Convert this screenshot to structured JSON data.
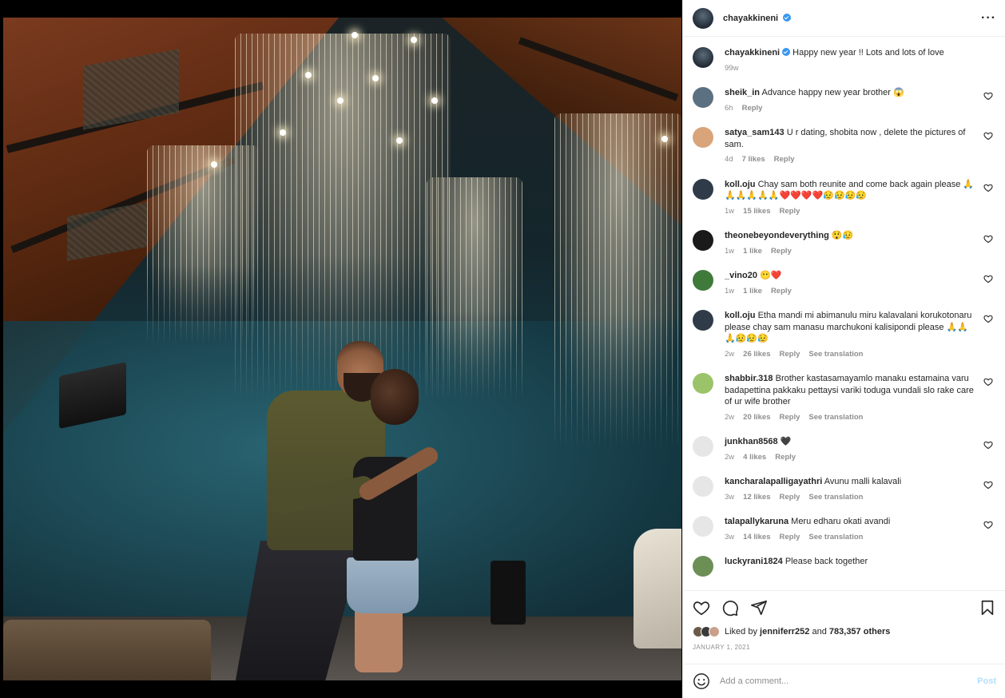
{
  "post": {
    "author": "chayakkineni",
    "verified": true,
    "more_icon": "more-horizontal-icon"
  },
  "caption": {
    "username": "chayakkineni",
    "text": "Happy new year !! Lots and lots of love",
    "time": "99w"
  },
  "comments": [
    {
      "username": "sheik_in",
      "text": "Advance happy new year brother 😱",
      "time": "6h",
      "likes": "",
      "reply": "Reply",
      "translate": ""
    },
    {
      "username": "satya_sam143",
      "text": "U r dating, shobita now , delete the pictures of sam.",
      "time": "4d",
      "likes": "7 likes",
      "reply": "Reply",
      "translate": ""
    },
    {
      "username": "koll.oju",
      "text": "Chay sam both reunite and come back again please 🙏🙏🙏🙏🙏🙏❤️❤️❤️❤️😥😥😥😥",
      "time": "1w",
      "likes": "15 likes",
      "reply": "Reply",
      "translate": ""
    },
    {
      "username": "theonebeyondeverything",
      "text": "😲😥",
      "time": "1w",
      "likes": "1 like",
      "reply": "Reply",
      "translate": ""
    },
    {
      "username": "_vino20",
      "text": "😶❤️",
      "time": "1w",
      "likes": "1 like",
      "reply": "Reply",
      "translate": ""
    },
    {
      "username": "koll.oju",
      "text": "Etha mandi mi abimanulu miru kalavalani korukotonaru please chay sam manasu marchukoni kalisipondi please 🙏🙏🙏😥😥😥",
      "time": "2w",
      "likes": "26 likes",
      "reply": "Reply",
      "translate": "See translation"
    },
    {
      "username": "shabbir.318",
      "text": "Brother kastasamayamlo manaku estamaina varu badapettina pakkaku pettaysi variki toduga vundali slo rake care of ur wife brother",
      "time": "2w",
      "likes": "20 likes",
      "reply": "Reply",
      "translate": "See translation"
    },
    {
      "username": "junkhan8568",
      "text": "🖤",
      "time": "2w",
      "likes": "4 likes",
      "reply": "Reply",
      "translate": ""
    },
    {
      "username": "kancharalapalligayathri",
      "text": "Avunu malli kalavali",
      "time": "3w",
      "likes": "12 likes",
      "reply": "Reply",
      "translate": "See translation"
    },
    {
      "username": "talapallykaruna",
      "text": "Meru edharu okati avandi",
      "time": "3w",
      "likes": "14 likes",
      "reply": "Reply",
      "translate": "See translation"
    },
    {
      "username": "luckyrani1824",
      "text": "Please back together",
      "time": "",
      "likes": "",
      "reply": "",
      "translate": ""
    }
  ],
  "avatars": [
    "#5b7080",
    "#d9a47a",
    "#2f3b48",
    "#1a1a1a",
    "#3f7a3a",
    "#2f3b48",
    "#9bc46a",
    "#e6e6e6",
    "#e6e6e6",
    "#e6e6e6",
    "#6b8f55"
  ],
  "actions": {
    "like_icon": "heart-icon",
    "comment_icon": "comment-icon",
    "share_icon": "send-icon",
    "save_icon": "bookmark-icon"
  },
  "likes": {
    "prefix": "Liked by",
    "user": "jenniferr252",
    "middle": "and",
    "others": "783,357 others"
  },
  "date": "JANUARY 1, 2021",
  "add_comment": {
    "emoji_icon": "emoji-icon",
    "placeholder": "Add a comment...",
    "post_label": "Post"
  },
  "colors": {
    "link": "#3897f0",
    "post_disabled": "#b2dffc",
    "muted": "#8e8e8e"
  }
}
